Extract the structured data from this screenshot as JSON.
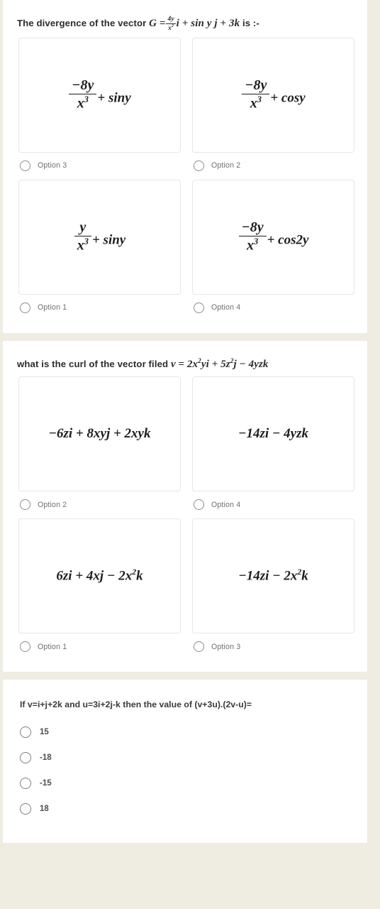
{
  "theme": {
    "page_background": "#efece1",
    "panel_background": "#ffffff",
    "card_border": "#e7e7e7",
    "text_primary": "#2c2c2c",
    "text_muted": "#6f6f6f",
    "radio_border": "#8d8d8d"
  },
  "questions": [
    {
      "id": "q1",
      "prompt_parts": {
        "lead": "The divergence of the vector",
        "symbol": "G",
        "equals": "=",
        "frac_num": "4y",
        "frac_den": "x",
        "frac_den_exp": "2",
        "after_frac": "i + sin y j + 3k",
        "tail": "is :-"
      },
      "prompt_text": "The divergence of the vector G = 4y/x² i + sin y j + 3k is :-",
      "options": [
        {
          "label": "Option 3",
          "math_type": "fraction",
          "num": "−8y",
          "den": "x",
          "den_exp": "3",
          "suffix": "+ siny",
          "math_text": "-8y/x^3 + siny"
        },
        {
          "label": "Option 2",
          "math_type": "fraction",
          "num": "−8y",
          "den": "x",
          "den_exp": "3",
          "suffix": "+ cosy",
          "math_text": "-8y/x^3 + cosy"
        },
        {
          "label": "Option 1",
          "math_type": "fraction",
          "num": "y",
          "den": "x",
          "den_exp": "3",
          "suffix": "+ siny",
          "math_text": "y/x^3 + siny"
        },
        {
          "label": "Option 4",
          "math_type": "fraction",
          "num": "−8y",
          "den": "x",
          "den_exp": "3",
          "suffix": "+ cos2y",
          "math_text": "-8y/x^3 + cos2y"
        }
      ]
    },
    {
      "id": "q2",
      "prompt_parts": {
        "lead": "what is the curl of the vector filed",
        "symbol": "v",
        "equals": "=",
        "expr_a": "2x",
        "expr_a_exp": "2",
        "expr_a_tail": "yi +",
        "expr_b": "5z",
        "expr_b_exp": "2",
        "expr_b_tail": "j − 4yzk"
      },
      "prompt_text": "what is the curl of the vector filed v = 2x²yi + 5z²j − 4yzk",
      "options": [
        {
          "label": "Option 2",
          "math_type": "inline",
          "math_text": "−6zi + 8xyj + 2xyk"
        },
        {
          "label": "Option 4",
          "math_type": "inline",
          "math_text": "−14zi − 4yzk"
        },
        {
          "label": "Option 1",
          "math_type": "inline_exp",
          "pre": "6zi + 4xj − 2x",
          "exp": "2",
          "post": "k",
          "math_text": "6zi + 4xj − 2x²k"
        },
        {
          "label": "Option 3",
          "math_type": "inline_exp",
          "pre": "−14zi − 2x",
          "exp": "2",
          "post": "k",
          "math_text": "−14zi − 2x²k"
        }
      ]
    },
    {
      "id": "q3",
      "prompt_text": "If v=i+j+2k and u=3i+2j-k then the value of (v+3u).(2v-u)=",
      "choices": [
        {
          "value": "15"
        },
        {
          "value": "-18"
        },
        {
          "value": "-15"
        },
        {
          "value": "18"
        }
      ]
    }
  ]
}
